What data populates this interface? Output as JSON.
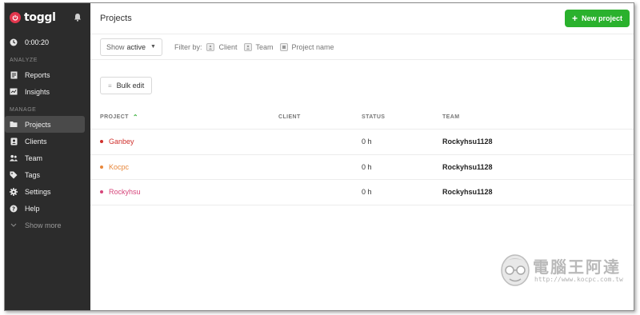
{
  "app": {
    "logo_text": "toggl",
    "brand_color": "#e2364d"
  },
  "sidebar": {
    "timer": "0:00:20",
    "sections": {
      "analyze": "ANALYZE",
      "manage": "MANAGE"
    },
    "analyze_items": [
      {
        "label": "Reports",
        "icon": "reports-icon"
      },
      {
        "label": "Insights",
        "icon": "insights-icon"
      }
    ],
    "manage_items": [
      {
        "label": "Projects",
        "icon": "folder-icon",
        "active": true
      },
      {
        "label": "Clients",
        "icon": "clients-icon"
      },
      {
        "label": "Team",
        "icon": "team-icon"
      },
      {
        "label": "Tags",
        "icon": "tag-icon"
      },
      {
        "label": "Settings",
        "icon": "gear-icon"
      },
      {
        "label": "Help",
        "icon": "help-icon"
      }
    ],
    "show_more": "Show more"
  },
  "header": {
    "title": "Projects",
    "new_button": "New project",
    "accent": "#2ab12d"
  },
  "filters": {
    "show_prefix": "Show",
    "show_value": "active",
    "filter_by_label": "Filter by:",
    "chips": [
      "Client",
      "Team",
      "Project name"
    ]
  },
  "bulk_edit": "Bulk edit",
  "table": {
    "columns": [
      "PROJECT",
      "CLIENT",
      "STATUS",
      "TEAM"
    ],
    "rows": [
      {
        "project": "Ganbey",
        "color": "#d0312d",
        "client": "",
        "status": "0 h",
        "team": "Rockyhsu1128"
      },
      {
        "project": "Kocpc",
        "color": "#e8873a",
        "client": "",
        "status": "0 h",
        "team": "Rockyhsu1128"
      },
      {
        "project": "Rockyhsu",
        "color": "#d6457a",
        "client": "",
        "status": "0 h",
        "team": "Rockyhsu1128"
      }
    ]
  },
  "watermark": {
    "title": "電腦王阿達",
    "url": "http://www.kocpc.com.tw"
  }
}
